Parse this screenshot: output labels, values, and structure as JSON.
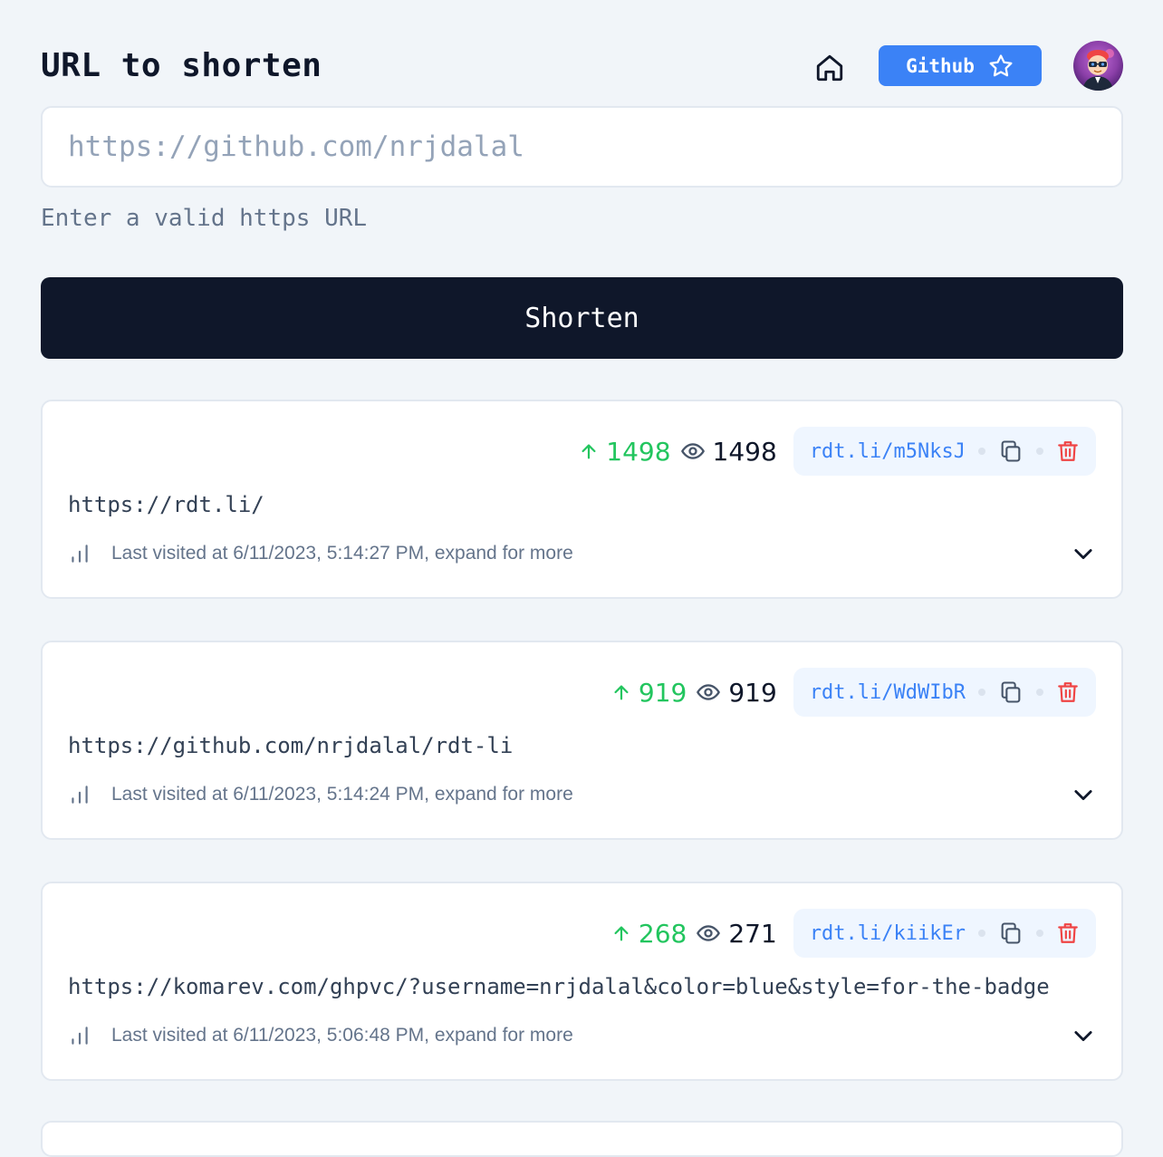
{
  "header": {
    "title": "URL to shorten",
    "github_label": "Github"
  },
  "form": {
    "url_placeholder": "https://github.com/nrjdalal",
    "hint": "Enter a valid https URL",
    "submit_label": "Shorten"
  },
  "links": [
    {
      "up": "1498",
      "views": "1498",
      "short_url": "rdt.li/m5NksJ",
      "long_url": "https://rdt.li/",
      "last_visited": "Last visited at 6/11/2023, 5:14:27 PM, expand for more"
    },
    {
      "up": "919",
      "views": "919",
      "short_url": "rdt.li/WdWIbR",
      "long_url": "https://github.com/nrjdalal/rdt-li",
      "last_visited": "Last visited at 6/11/2023, 5:14:24 PM, expand for more"
    },
    {
      "up": "268",
      "views": "271",
      "short_url": "rdt.li/kiikEr",
      "long_url": "https://komarev.com/ghpvc/?username=nrjdalal&color=blue&style=for-the-badge",
      "last_visited": "Last visited at 6/11/2023, 5:06:48 PM, expand for more"
    }
  ],
  "icons": {
    "home": "home-icon",
    "star": "star-icon",
    "arrow_up": "arrow-up-icon",
    "eye": "eye-icon",
    "copy": "copy-icon",
    "trash": "trash-icon",
    "bar_chart": "bar-chart-icon",
    "chevron_down": "chevron-down-icon"
  },
  "colors": {
    "background": "#f1f5f9",
    "primary_dark": "#0f172a",
    "accent_blue": "#3b82f6",
    "up_green": "#22c55e",
    "delete_red": "#ef4444"
  }
}
